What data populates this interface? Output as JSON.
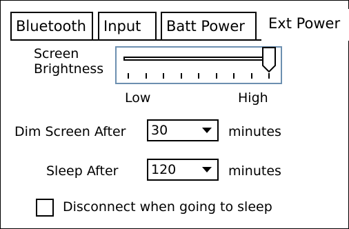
{
  "tabs": [
    {
      "label": "Bluetooth",
      "active": false
    },
    {
      "label": "Input",
      "active": false
    },
    {
      "label": "Batt Power",
      "active": false
    },
    {
      "label": "Ext Power",
      "active": true
    }
  ],
  "brightness": {
    "label_line1": "Screen",
    "label_line2": "Brightness",
    "low_label": "Low",
    "high_label": "High",
    "level": 1.0,
    "tick_count": 9,
    "focus_color": "#6c8fb0"
  },
  "dim_screen": {
    "label": "Dim Screen After",
    "value": "30",
    "unit": "minutes"
  },
  "sleep": {
    "label": "Sleep After",
    "value": "120",
    "unit": "minutes"
  },
  "disconnect": {
    "label": "Disconnect when going to sleep",
    "checked": false
  }
}
